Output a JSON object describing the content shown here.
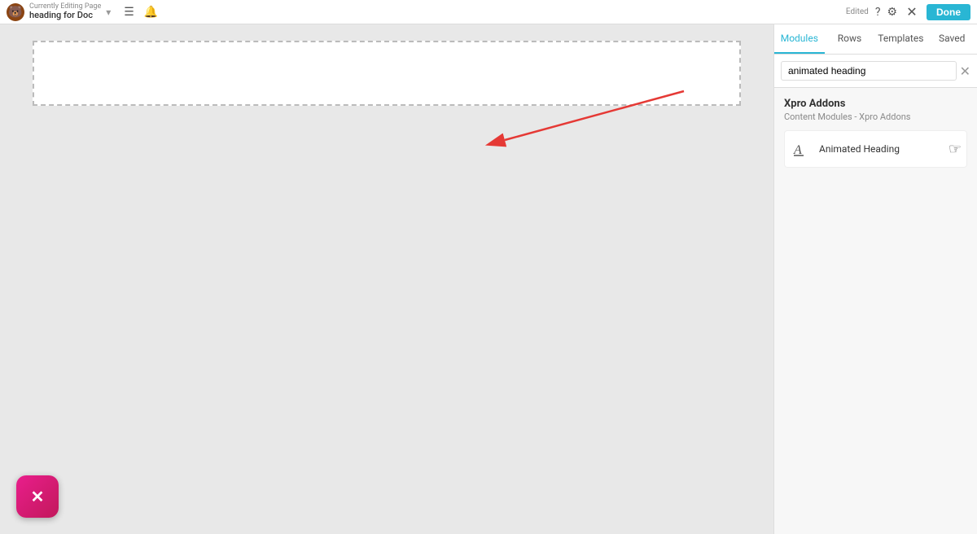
{
  "topbar": {
    "subtitle": "Currently Editing Page",
    "title": "heading for Doc",
    "edited_label": "Edited",
    "done_label": "Done",
    "avatar_initials": "🐻"
  },
  "panel": {
    "tabs": [
      {
        "label": "Modules",
        "active": true
      },
      {
        "label": "Rows",
        "active": false
      },
      {
        "label": "Templates",
        "active": false
      },
      {
        "label": "Saved",
        "active": false
      }
    ],
    "search_placeholder": "animated heading",
    "search_value": "animated heading",
    "section_title": "Xpro Addons",
    "section_sub": "Content Modules - Xpro Addons",
    "modules": [
      {
        "label": "Animated Heading",
        "icon": "A"
      }
    ]
  },
  "canvas": {
    "block_placeholder": ""
  },
  "close_button_label": "✕"
}
